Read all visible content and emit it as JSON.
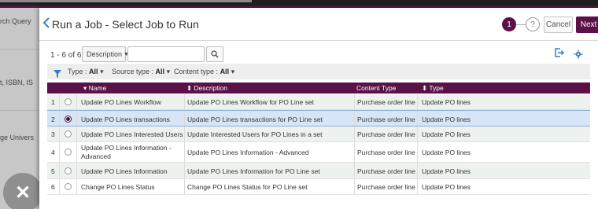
{
  "background": {
    "fragments": [
      "rch Query",
      "t, ISBN, IS",
      "ge Univers"
    ]
  },
  "header": {
    "back_icon": "chevron-left-icon",
    "title": "Run a Job - Select Job to Run",
    "steps": [
      "1",
      "?"
    ],
    "cancel_label": "Cancel",
    "next_label": "Next"
  },
  "toolbar": {
    "count": "1 - 6 of 6",
    "search_field": "Description",
    "search_placeholder": "",
    "search_icon": "search-icon",
    "export_icon": "export-icon",
    "settings_icon": "gear-icon"
  },
  "filters": {
    "icon": "filter-icon",
    "type_label": "Type :",
    "type_value": "All",
    "source_label": "Source type :",
    "source_value": "All",
    "content_label": "Content type :",
    "content_value": "All"
  },
  "table": {
    "columns": [
      "▾ Name",
      "⬍ Description",
      "Content Type",
      "⬍ Type"
    ],
    "rows": [
      {
        "num": "1",
        "name": "Update PO Lines Workflow",
        "description": "Update PO Lines Workflow for PO Line set",
        "content_type": "Purchase order line",
        "type": "Update PO lines",
        "selected": false
      },
      {
        "num": "2",
        "name": "Update PO Lines transactions",
        "description": "Update PO Lines transactions for PO Line set",
        "content_type": "Purchase order line",
        "type": "Update PO lines",
        "selected": true
      },
      {
        "num": "3",
        "name": "Update PO Lines Interested Users",
        "description": "Update Interested Users for PO Lines in a set",
        "content_type": "Purchase order line",
        "type": "Update PO lines",
        "selected": false
      },
      {
        "num": "4",
        "name": "Update PO Lines Information - Advanced",
        "description": "Update PO Lines Information - Advanced",
        "content_type": "Purchase order line",
        "type": "Update PO lines",
        "selected": false
      },
      {
        "num": "5",
        "name": "Update PO Lines Information",
        "description": "Update PO Lines Information for PO Line set",
        "content_type": "Purchase order line",
        "type": "Update PO lines",
        "selected": false
      },
      {
        "num": "6",
        "name": "Change PO Lines Status",
        "description": "Change PO Lines Status for PO Line set",
        "content_type": "Purchase order line",
        "type": "Update PO lines",
        "selected": false
      }
    ]
  },
  "colors": {
    "brand": "#5a1148",
    "link": "#3b7dc4",
    "selected_row": "#d6e6f6"
  }
}
